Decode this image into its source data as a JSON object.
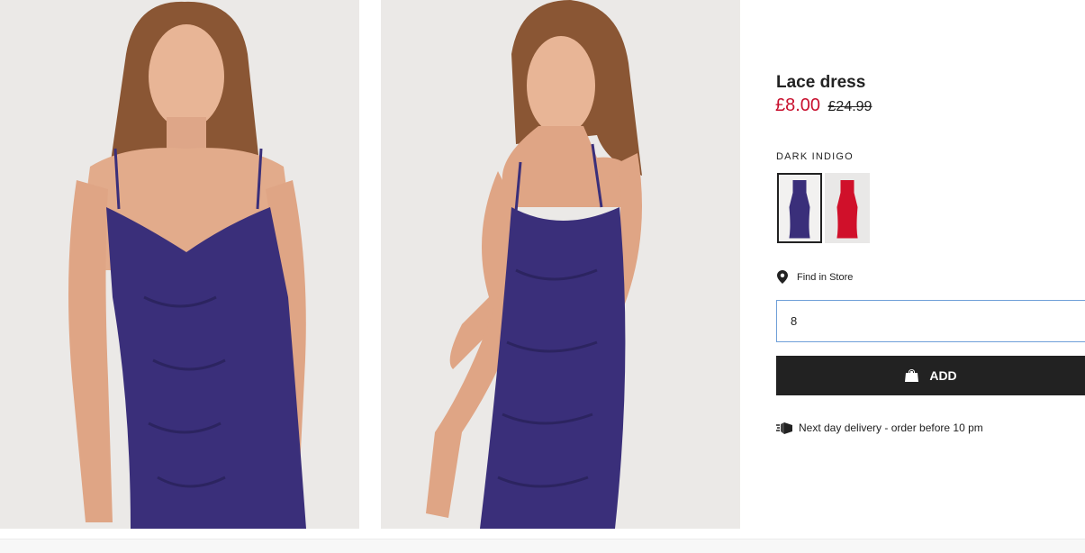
{
  "product": {
    "title": "Lace dress",
    "price_sale": "£8.00",
    "price_original": "£24.99"
  },
  "colors": {
    "selected_name": "DARK INDIGO",
    "swatches": [
      {
        "name": "dark-indigo",
        "color": "#3a2f7a",
        "selected": true
      },
      {
        "name": "red",
        "color": "#d0102a",
        "selected": false
      }
    ]
  },
  "store": {
    "find_label": "Find in Store"
  },
  "size": {
    "value": "8"
  },
  "cart": {
    "add_label": "ADD"
  },
  "delivery": {
    "text": "Next day delivery - order before 10 pm"
  },
  "images": [
    {
      "alt": "model-front"
    },
    {
      "alt": "model-side"
    }
  ]
}
